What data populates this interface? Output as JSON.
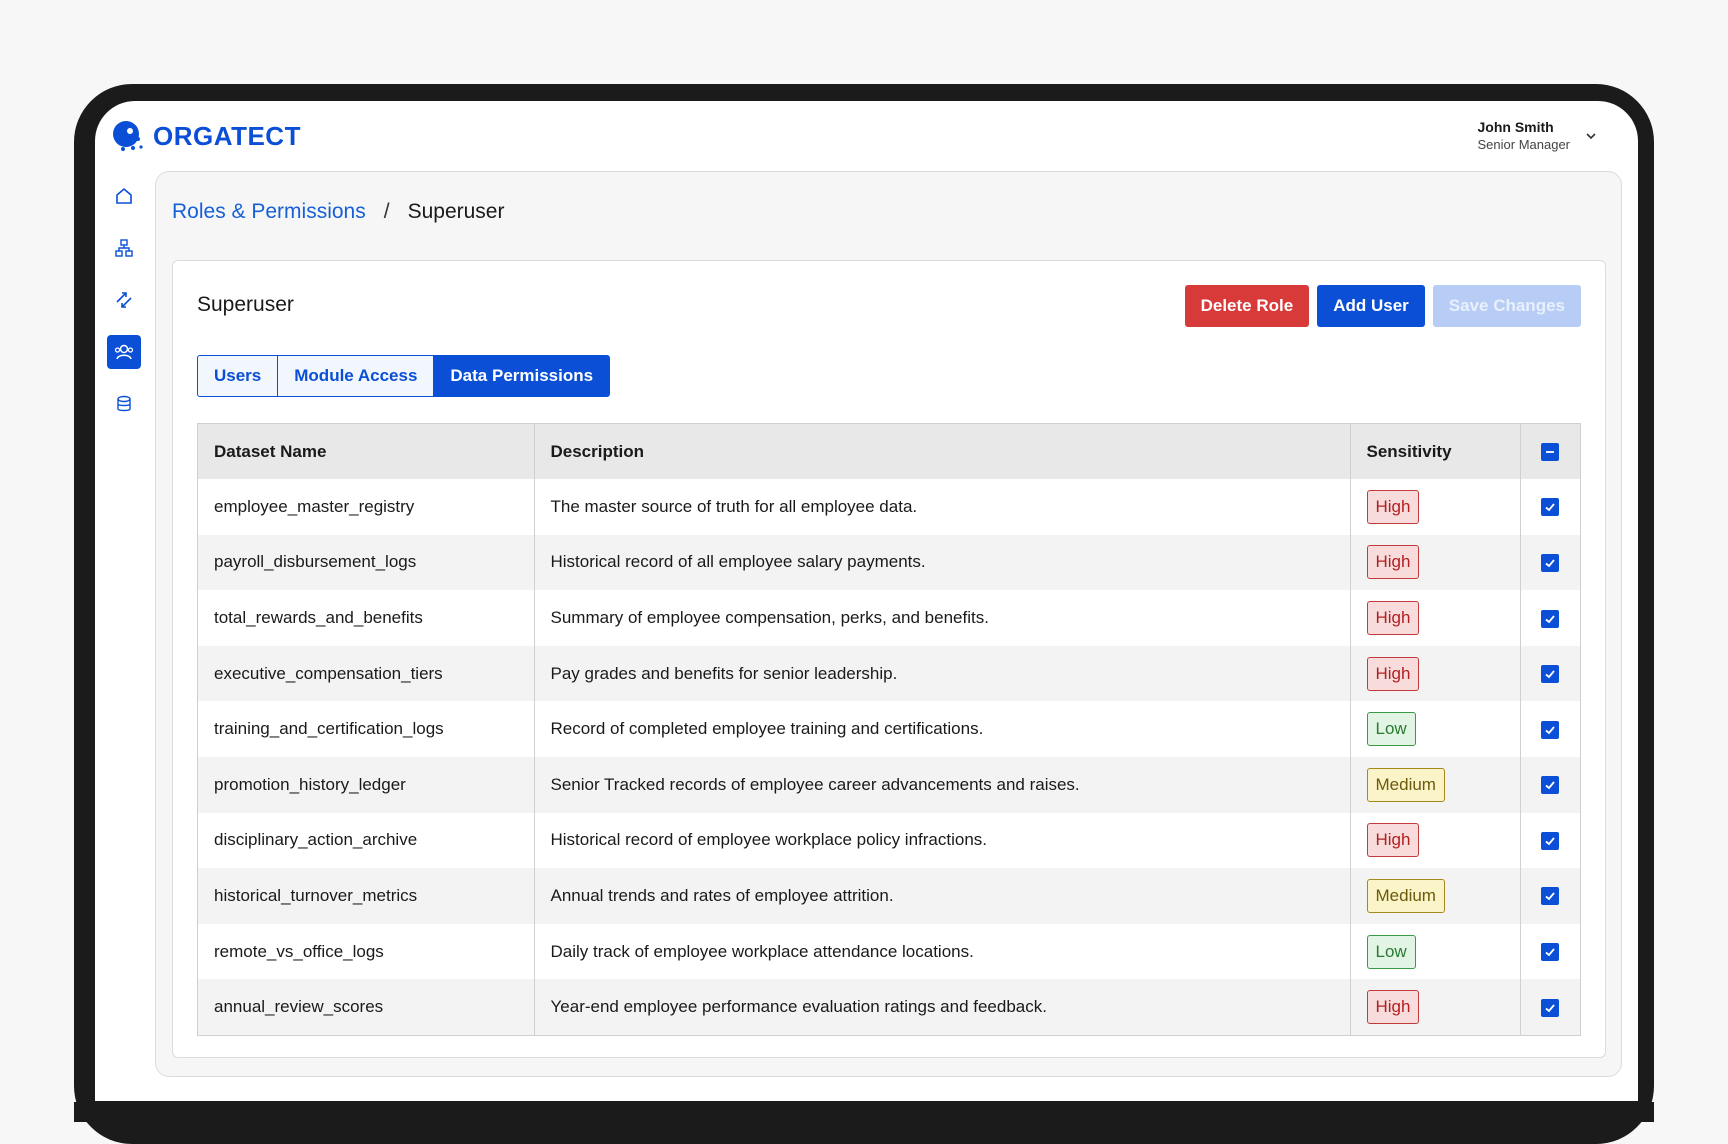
{
  "app": {
    "brand": "ORGATECT"
  },
  "user": {
    "name": "John Smith",
    "role": "Senior Manager"
  },
  "sidebar": {
    "items": [
      {
        "name": "home",
        "icon": "home-icon",
        "active": false
      },
      {
        "name": "org-chart",
        "icon": "org-chart-icon",
        "active": false
      },
      {
        "name": "transfers",
        "icon": "arrows-icon",
        "active": false
      },
      {
        "name": "people",
        "icon": "users-icon",
        "active": true
      },
      {
        "name": "data",
        "icon": "database-icon",
        "active": false
      }
    ]
  },
  "breadcrumb": {
    "parent": "Roles & Permissions",
    "separator": "/",
    "current": "Superuser"
  },
  "role": {
    "title": "Superuser"
  },
  "actions": {
    "delete": "Delete Role",
    "add_user": "Add User",
    "save": "Save Changes"
  },
  "tabs": [
    {
      "label": "Users",
      "active": false
    },
    {
      "label": "Module Access",
      "active": false
    },
    {
      "label": "Data Permissions",
      "active": true
    }
  ],
  "table": {
    "headers": {
      "name": "Dataset Name",
      "description": "Description",
      "sensitivity": "Sensitivity"
    },
    "header_checkbox": "indeterminate",
    "rows": [
      {
        "name": "employee_master_registry",
        "description": "The master source of truth for all employee data.",
        "sensitivity": "High",
        "checked": true
      },
      {
        "name": "payroll_disbursement_logs",
        "description": "Historical record of all employee salary payments.",
        "sensitivity": "High",
        "checked": true
      },
      {
        "name": "total_rewards_and_benefits",
        "description": "Summary of employee compensation, perks, and benefits.",
        "sensitivity": "High",
        "checked": true
      },
      {
        "name": "executive_compensation_tiers",
        "description": "Pay grades and benefits for senior leadership.",
        "sensitivity": "High",
        "checked": true
      },
      {
        "name": "training_and_certification_logs",
        "description": "Record of completed employee training and certifications.",
        "sensitivity": "Low",
        "checked": true
      },
      {
        "name": "promotion_history_ledger",
        "description": "Senior Tracked records of employee career advancements and raises.",
        "sensitivity": "Medium",
        "checked": true
      },
      {
        "name": "disciplinary_action_archive",
        "description": "Historical record of employee workplace policy infractions.",
        "sensitivity": "High",
        "checked": true
      },
      {
        "name": "historical_turnover_metrics",
        "description": "Annual trends and rates of employee attrition.",
        "sensitivity": "Medium",
        "checked": true
      },
      {
        "name": "remote_vs_office_logs",
        "description": "Daily track of employee workplace attendance locations.",
        "sensitivity": "Low",
        "checked": true
      },
      {
        "name": "annual_review_scores",
        "description": "Year-end employee performance evaluation ratings and feedback.",
        "sensitivity": "High",
        "checked": true
      }
    ]
  },
  "colors": {
    "accent": "#0b4fd6",
    "danger": "#d83a3a",
    "disabled": "#b7cdf5"
  }
}
